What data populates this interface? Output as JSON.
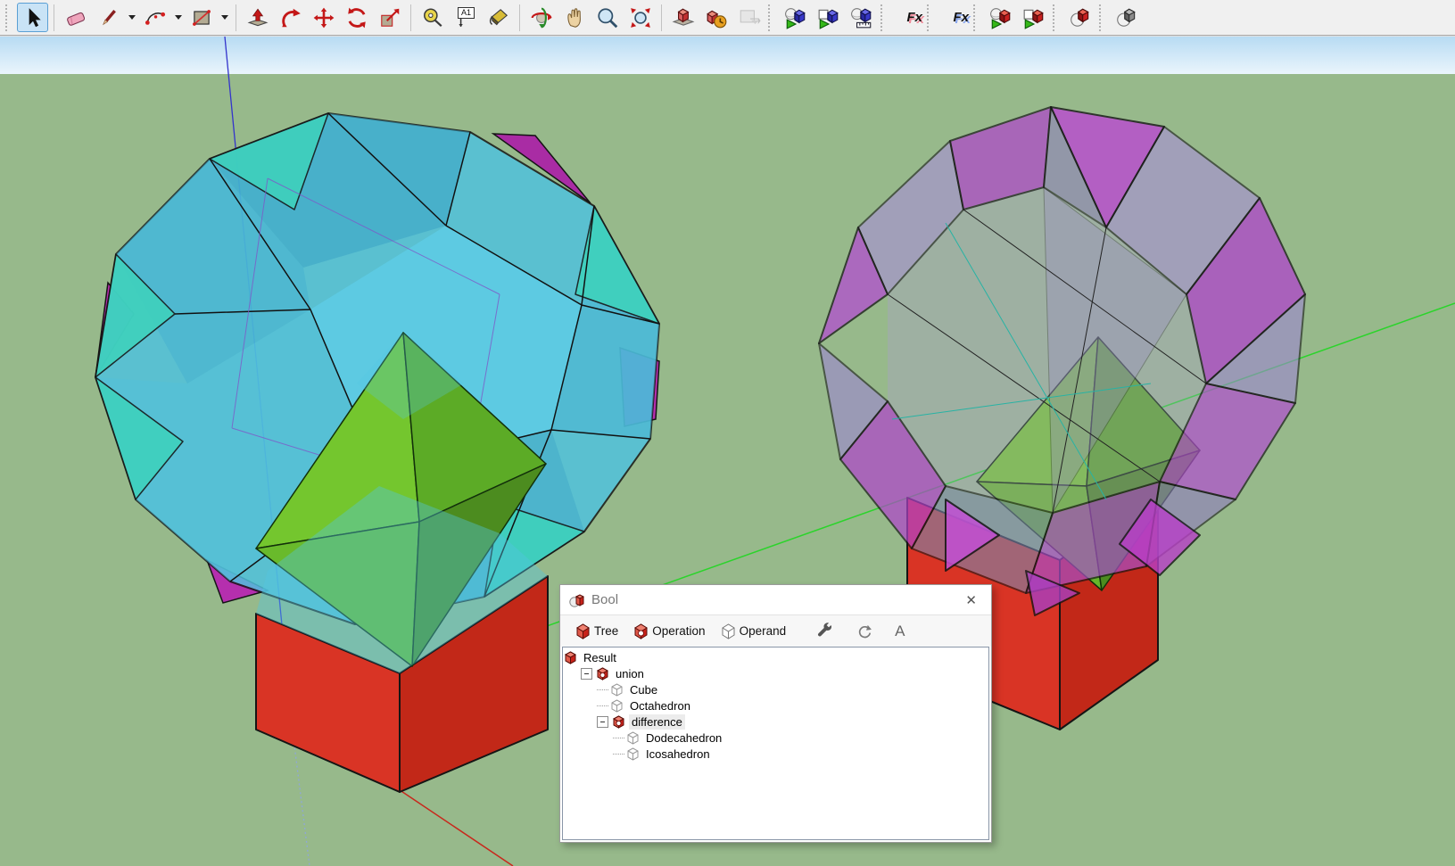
{
  "toolbar": {
    "labels": {
      "text_tool": "A1",
      "fx": "Fx"
    },
    "items": [
      {
        "type": "handle"
      },
      {
        "name": "select",
        "active": true
      },
      {
        "type": "sep"
      },
      {
        "name": "eraser"
      },
      {
        "name": "line",
        "dropdown": true
      },
      {
        "name": "arc",
        "dropdown": true
      },
      {
        "name": "shape",
        "dropdown": true
      },
      {
        "type": "sep"
      },
      {
        "name": "pushpull"
      },
      {
        "name": "followme"
      },
      {
        "name": "move"
      },
      {
        "name": "rotate"
      },
      {
        "name": "scale"
      },
      {
        "type": "sep"
      },
      {
        "name": "tape-measure"
      },
      {
        "name": "text",
        "text": "toolbar.labels.text_tool"
      },
      {
        "name": "paint-bucket"
      },
      {
        "type": "sep"
      },
      {
        "name": "orbit"
      },
      {
        "name": "pan"
      },
      {
        "name": "zoom"
      },
      {
        "name": "zoom-extents"
      },
      {
        "type": "sep"
      },
      {
        "name": "model-info"
      },
      {
        "name": "model-warehouse"
      },
      {
        "name": "export",
        "disabled": true
      },
      {
        "type": "handle"
      },
      {
        "name": "bool-union-blue"
      },
      {
        "name": "bool-subtract-blue"
      },
      {
        "name": "bool-edit-blue"
      },
      {
        "type": "handle"
      },
      {
        "name": "fx-red",
        "text": "toolbar.labels.fx",
        "cls": "fxr"
      },
      {
        "type": "handle"
      },
      {
        "name": "fx-blue",
        "text": "toolbar.labels.fx",
        "cls": "fxb"
      },
      {
        "type": "handle"
      },
      {
        "name": "bool-union-red"
      },
      {
        "name": "bool-subtract-red"
      },
      {
        "type": "handle"
      },
      {
        "name": "bool-solid-red"
      },
      {
        "type": "handle"
      },
      {
        "name": "bool-solid-gray"
      }
    ]
  },
  "dialog": {
    "title": "Bool",
    "close_glyph": "✕",
    "toolbar": {
      "tree": "Tree",
      "operation": "Operation",
      "operand": "Operand",
      "text_button": "A"
    },
    "tree": [
      {
        "label": "Result",
        "icon": "result",
        "level": 0,
        "expander": false,
        "selected": false
      },
      {
        "label": "union",
        "icon": "op",
        "level": 1,
        "expander": true,
        "selected": false
      },
      {
        "label": "Cube",
        "icon": "operand",
        "level": 2,
        "expander": false,
        "selected": false
      },
      {
        "label": "Octahedron",
        "icon": "operand",
        "level": 2,
        "expander": false,
        "selected": false
      },
      {
        "label": "difference",
        "icon": "op",
        "level": 2,
        "expander": true,
        "selected": true
      },
      {
        "label": "Dodecahedron",
        "icon": "operand",
        "level": 3,
        "expander": false,
        "selected": false
      },
      {
        "label": "Icosahedron",
        "icon": "operand",
        "level": 3,
        "expander": false,
        "selected": false
      }
    ]
  },
  "colors": {
    "toolbar_bg": "#f0f0f0",
    "sky_top": "#b7dbf3",
    "sky_bottom": "#eaf5fc",
    "ground": "#97b98b",
    "axis_red": "#c8281c",
    "axis_green": "#2bd42b",
    "axis_blue": "#3333cc",
    "axis_blue_hidden": "#8fa8d8",
    "cyan_face": "#4fc2de",
    "teal_face": "#3aa3c4",
    "turquoise_face": "#3ed2bc",
    "magenta_face": "#b52fae",
    "purple_bright": "#bb49d2",
    "purple_light": "#a88fd8",
    "purple_gray": "#7d87ad",
    "green_bright": "#74c62e",
    "green_dark": "#4c8c1f",
    "red_face": "#d93425",
    "red_face_dark": "#c22818",
    "edge": "#151515",
    "selection_bg": "#ececec"
  }
}
